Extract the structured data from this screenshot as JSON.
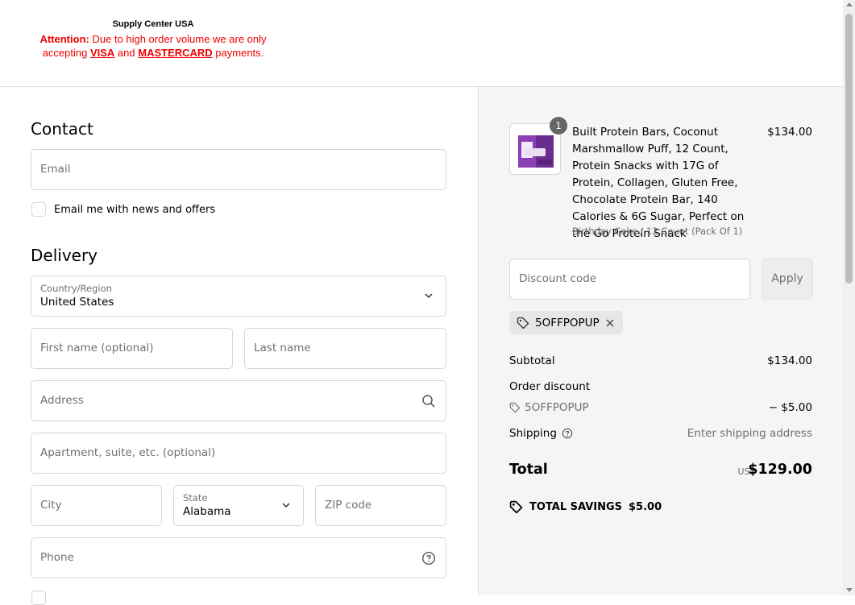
{
  "header": {
    "logo_title": "Supply Center USA",
    "notice_prefix": "Attention:",
    "notice_line1": " Due to high order volume we are only",
    "notice_line2a": "accepting ",
    "notice_visa": "VISA",
    "notice_and": " and ",
    "notice_mastercard": "MASTERCARD",
    "notice_line2b": " payments."
  },
  "contact": {
    "title": "Contact",
    "email_placeholder": "Email",
    "newsletter_label": "Email me with news and offers"
  },
  "delivery": {
    "title": "Delivery",
    "country_label": "Country/Region",
    "country_value": "United States",
    "first_name_placeholder": "First name (optional)",
    "last_name_placeholder": "Last name",
    "address_placeholder": "Address",
    "apartment_placeholder": "Apartment, suite, etc. (optional)",
    "city_placeholder": "City",
    "state_label": "State",
    "state_value": "Alabama",
    "zip_placeholder": "ZIP code",
    "phone_placeholder": "Phone"
  },
  "order": {
    "quantity": "1",
    "product_title": "Built Protein Bars, Coconut Marshmallow Puff, 12 Count, Protein Snacks with 17G of Protein, Collagen, Gluten Free, Chocolate Protein Bar, 140 Calories & 6G Sugar, Perfect on the Go Protein Snack",
    "product_variant": "Birthday Cake / 12 Count (Pack Of 1)",
    "product_price": "$134.00",
    "discount_placeholder": "Discount code",
    "apply_label": "Apply",
    "applied_code": "5OFFPOPUP",
    "subtotal_label": "Subtotal",
    "subtotal_value": "$134.00",
    "order_discount_label": "Order discount",
    "discount_code": "5OFFPOPUP",
    "discount_value": "− $5.00",
    "shipping_label": "Shipping",
    "shipping_value": "Enter shipping address",
    "total_label": "Total",
    "currency": "USD",
    "total_value": "$129.00",
    "savings_label": "TOTAL SAVINGS",
    "savings_value": "$5.00"
  },
  "colors": {
    "notice_red": "#ee0000",
    "summary_bg": "#f5f5f5",
    "product_purple": "#6a2c8f"
  }
}
